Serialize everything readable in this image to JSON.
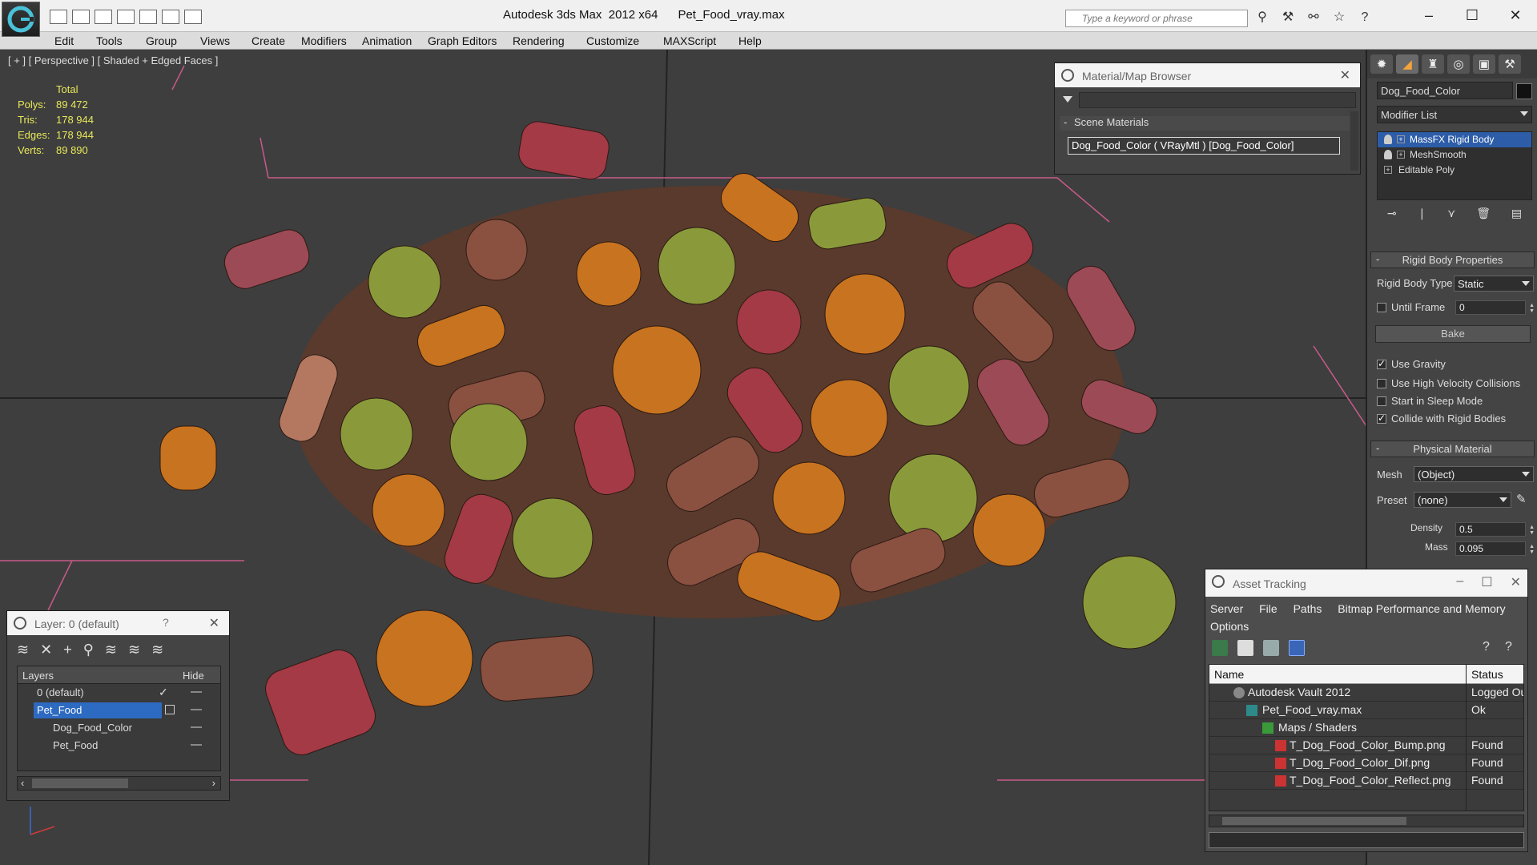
{
  "app": {
    "title": "Autodesk 3ds Max  2012 x64      Pet_Food_vray.max",
    "search_placeholder": "Type a keyword or phrase"
  },
  "menu": [
    "Edit",
    "Tools",
    "Group",
    "Views",
    "Create",
    "Modifiers",
    "Animation",
    "Graph Editors",
    "Rendering",
    "Customize",
    "MAXScript",
    "Help"
  ],
  "viewport": {
    "label": "[ + ] [ Perspective ] [ Shaded + Edged Faces ]",
    "stats": {
      "header": "Total",
      "rows": [
        {
          "k": "Polys:",
          "v": "89 472"
        },
        {
          "k": "Tris:",
          "v": "178 944"
        },
        {
          "k": "Edges:",
          "v": "178 944"
        },
        {
          "k": "Verts:",
          "v": "89 890"
        }
      ]
    }
  },
  "command_panel": {
    "object_name": "Dog_Food_Color",
    "modifier_list": "Modifier List",
    "stack": [
      {
        "label": "MassFX Rigid Body",
        "selected": true
      },
      {
        "label": "MeshSmooth",
        "selected": false
      },
      {
        "label": "Editable Poly",
        "selected": false
      }
    ],
    "rigid_body": {
      "header": "Rigid Body Properties",
      "type_label": "Rigid Body Type",
      "type_value": "Static",
      "until_frame_label": "Until Frame",
      "until_frame_value": "0",
      "bake": "Bake",
      "use_gravity": "Use Gravity",
      "high_velocity": "Use High Velocity Collisions",
      "sleep_mode": "Start in Sleep Mode",
      "collide": "Collide with Rigid Bodies"
    },
    "physical_material": {
      "header": "Physical Material",
      "mesh_label": "Mesh",
      "mesh_value": "(Object)",
      "preset_label": "Preset",
      "preset_value": "(none)",
      "density_label": "Density",
      "density_value": "0.5",
      "mass_label": "Mass",
      "mass_value": "0.095"
    }
  },
  "material_browser": {
    "title": "Material/Map Browser",
    "group": "Scene Materials",
    "item": "Dog_Food_Color ( VRayMtl ) [Dog_Food_Color]"
  },
  "layer_window": {
    "title": "Layer: 0 (default)",
    "help": "?",
    "col_layers": "Layers",
    "col_hide": "Hide",
    "rows": [
      {
        "name": "0 (default)"
      },
      {
        "name": "Pet_Food"
      },
      {
        "name": "Dog_Food_Color"
      },
      {
        "name": "Pet_Food"
      }
    ]
  },
  "asset_window": {
    "title": "Asset Tracking",
    "menu": [
      "Server",
      "File",
      "Paths",
      "Bitmap Performance and Memory",
      "Options"
    ],
    "col_name": "Name",
    "col_status": "Status",
    "rows": [
      {
        "name": "Autodesk Vault 2012",
        "status": "Logged Ou"
      },
      {
        "name": "Pet_Food_vray.max",
        "status": "Ok"
      },
      {
        "name": "Maps / Shaders",
        "status": ""
      },
      {
        "name": "T_Dog_Food_Color_Bump.png",
        "status": "Found"
      },
      {
        "name": "T_Dog_Food_Color_Dif.png",
        "status": "Found"
      },
      {
        "name": "T_Dog_Food_Color_Reflect.png",
        "status": "Found"
      }
    ]
  },
  "colors": {
    "viewport_bg": "#3e3e3e",
    "stats_text": "#e8e85a",
    "selection_blue": "#2d5da8",
    "kibble_red": "#a33a45",
    "kibble_orange": "#c8731f",
    "kibble_green": "#8a9a3a",
    "kibble_brown": "#6b3d2c"
  }
}
